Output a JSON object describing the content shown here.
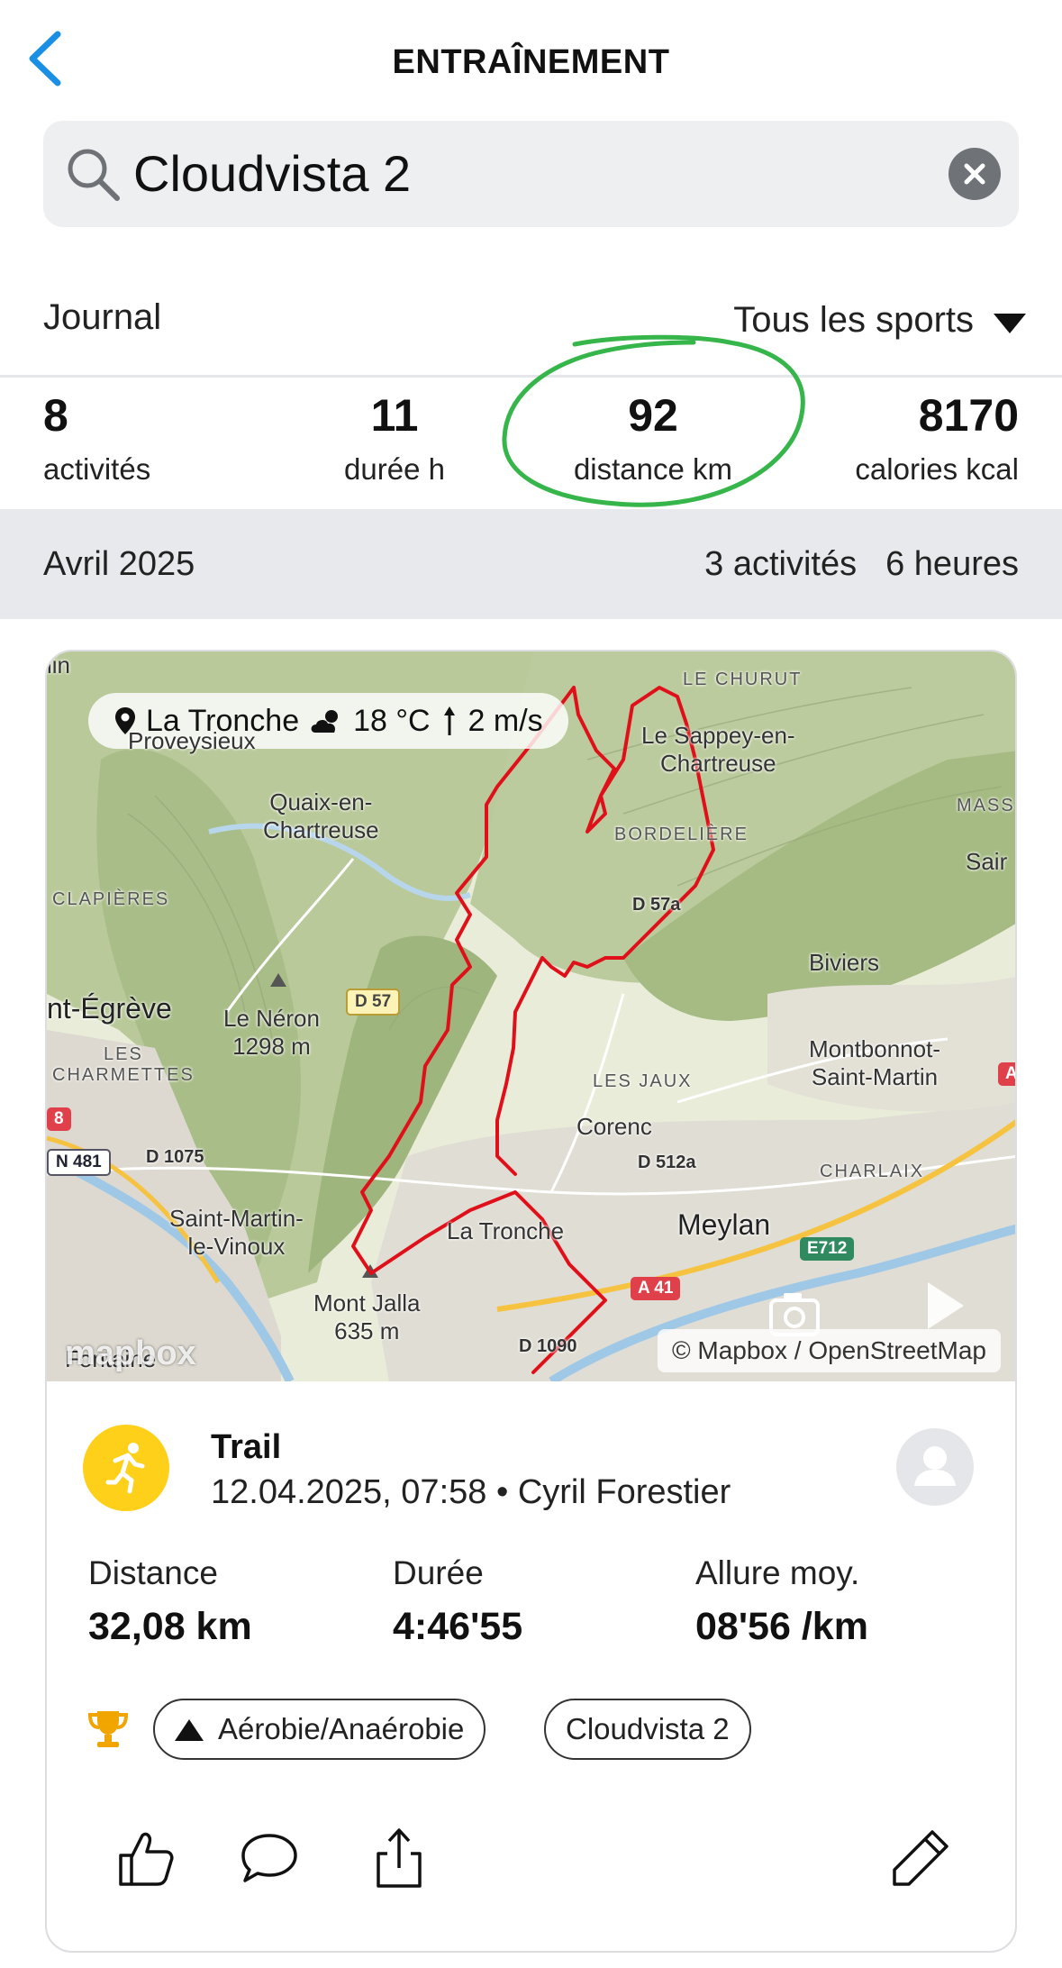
{
  "header": {
    "title": "ENTRAÎNEMENT"
  },
  "search": {
    "value": "Cloudvista 2"
  },
  "filter": {
    "journal_label": "Journal",
    "sport_filter": "Tous les sports"
  },
  "summary": [
    {
      "value": "8",
      "label": "activités"
    },
    {
      "value": "11",
      "label": "durée h"
    },
    {
      "value": "92",
      "label": "distance km"
    },
    {
      "value": "8170",
      "label": "calories kcal"
    }
  ],
  "month": {
    "label": "Avril 2025",
    "activities": "3 activités",
    "hours": "6 heures"
  },
  "activity": {
    "weather": {
      "location": "La Tronche",
      "temperature": "18 °C",
      "wind": "2 m/s"
    },
    "map_labels": {
      "proveysieux": "Proveysieux",
      "quaix": "Quaix-en-\nChartreuse",
      "le_churut": "LE CHURUT",
      "sappey": "Le Sappey-en-\nChartreuse",
      "bordeliere": "BORDELIÈRE",
      "mass": "MASS",
      "sair": "Sair",
      "clapieres": "CLAPIÈRES",
      "biviers": "Biviers",
      "st_egreve": "nt-Égrève",
      "le_neron": "Le Néron\n1298 m",
      "charmettes": "LES\nCHARMETTES",
      "montbonnot": "Montbonnot-\nSaint-Martin",
      "les_jaux": "LES JAUX",
      "corenc": "Corenc",
      "charlaix": "CHARLAIX",
      "st_martin_le_vinoux": "Saint-Martin-\nle-Vinoux",
      "la_tronche": "La Tronche",
      "meylan": "Meylan",
      "mont_jalla": "Mont Jalla\n635 m",
      "fontaine": "Fontaine",
      "lin": "lin"
    },
    "roads": {
      "d57": "D 57",
      "d57a": "D 57a",
      "n481": "N 481",
      "d1075": "D 1075",
      "d512a": "D 512a",
      "a41": "A 41",
      "e712": "E712",
      "d1090": "D 1090",
      "r8": "8",
      "ra": "A"
    },
    "mapbox_logo": "mapbox",
    "attribution": "© Mapbox / OpenStreetMap",
    "sport": "Trail",
    "meta": "12.04.2025, 07:58 • Cyril Forestier",
    "metrics": [
      {
        "label": "Distance",
        "value": "32,08 km"
      },
      {
        "label": "Durée",
        "value": "4:46'55"
      },
      {
        "label": "Allure moy.",
        "value": "08'56 /km"
      }
    ],
    "tags": [
      "Aérobie/Anaérobie",
      "Cloudvista 2"
    ]
  },
  "colors": {
    "accent_blue": "#1a8fe6",
    "route_red": "#e0101a",
    "highlight_green": "#36b64a",
    "sport_yellow": "#ffd01a",
    "trophy_gold": "#f0a500"
  }
}
